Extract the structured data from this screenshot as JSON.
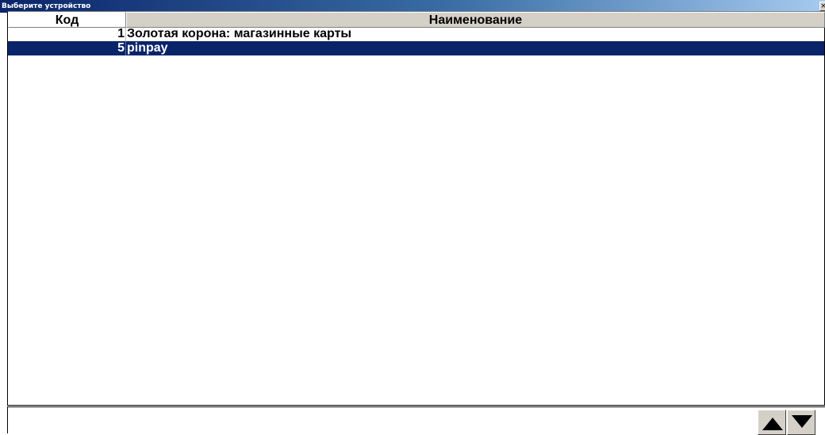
{
  "window": {
    "title": "Выберите устройство",
    "close_label": "×"
  },
  "table": {
    "columns": [
      "Код",
      "Наименование"
    ],
    "rows": [
      {
        "code": "1",
        "name": "Золотая корона: магазинные карты",
        "selected": false
      },
      {
        "code": "5",
        "name": "pinpay",
        "selected": true
      }
    ]
  },
  "footer": {
    "scroll_up_icon": "up-triangle-icon",
    "scroll_down_icon": "down-triangle-icon"
  },
  "colors": {
    "title_bar_start": "#0a246a",
    "title_bar_end": "#a6caf0",
    "selection": "#0a246a",
    "header_bg": "#d4d0c8"
  }
}
